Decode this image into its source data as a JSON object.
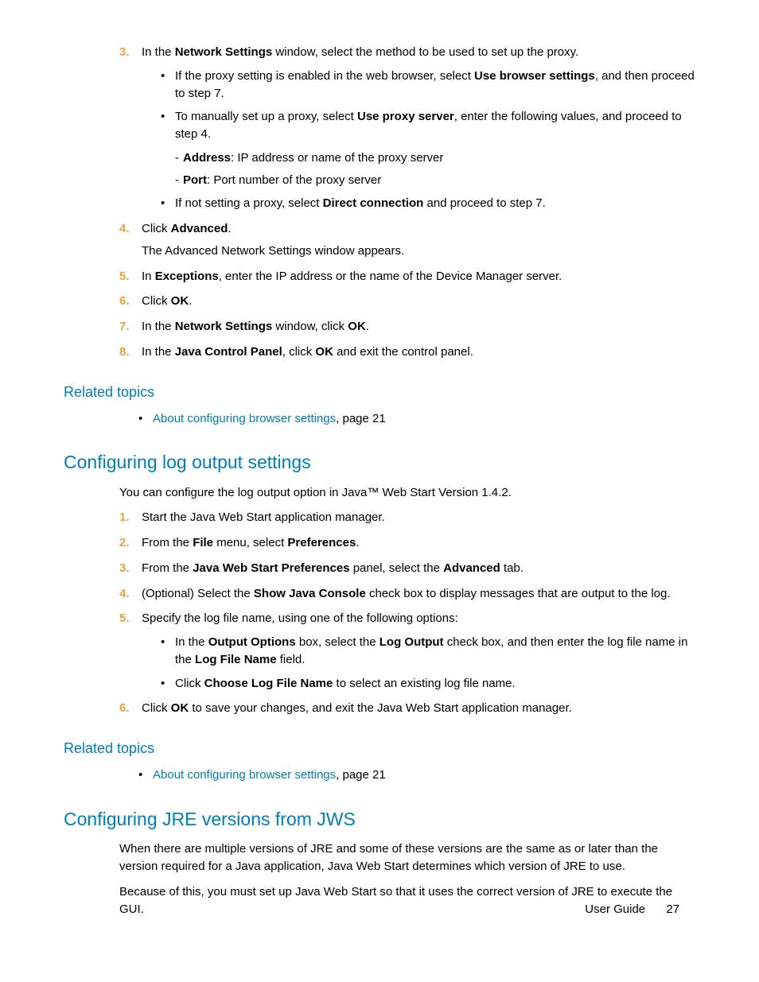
{
  "list1": {
    "n3": "3.",
    "i3a": "In the ",
    "i3b": "Network Settings",
    "i3c": " window, select the method to be used to set up the proxy.",
    "b1a": "If the proxy setting is enabled in the web browser, select ",
    "b1b": "Use browser settings",
    "b1c": ", and then proceed to step 7.",
    "b2a": "To manually set up a proxy, select ",
    "b2b": "Use proxy server",
    "b2c": ", enter the following values, and proceed to step 4.",
    "d1a": "Address",
    "d1b": ": IP address or name of the proxy server",
    "d2a": "Port",
    "d2b": ": Port number of the proxy server",
    "b3a": "If not setting a proxy, select ",
    "b3b": "Direct connection",
    "b3c": " and proceed to step 7.",
    "n4": "4.",
    "i4a": "Click ",
    "i4b": "Advanced",
    "i4c": ".",
    "i4d": "The Advanced Network Settings window appears.",
    "n5": "5.",
    "i5a": "In ",
    "i5b": "Exceptions",
    "i5c": ", enter the IP address or the name of the Device Manager server.",
    "n6": "6.",
    "i6a": "Click ",
    "i6b": "OK",
    "i6c": ".",
    "n7": "7.",
    "i7a": "In the ",
    "i7b": "Network Settings",
    "i7c": " window, click ",
    "i7d": "OK",
    "i7e": ".",
    "n8": "8.",
    "i8a": "In the ",
    "i8b": "Java Control Panel",
    "i8c": ", click ",
    "i8d": "OK",
    "i8e": " and exit the control panel."
  },
  "rel1": {
    "heading": "Related topics",
    "linkA": "About configuring browser settings",
    "linkB": ", page 21"
  },
  "sec2": {
    "title": "Configuring log output settings",
    "intro": "You can configure the log output option in Java™ Web Start Version 1.4.2.",
    "n1": "1.",
    "i1": "Start the Java Web Start application manager.",
    "n2": "2.",
    "i2a": "From the ",
    "i2b": "File",
    "i2c": " menu, select ",
    "i2d": "Preferences",
    "i2e": ".",
    "n3": "3.",
    "i3a": "From the ",
    "i3b": "Java Web Start Preferences",
    "i3c": " panel, select the ",
    "i3d": "Advanced",
    "i3e": " tab.",
    "n4": "4.",
    "i4a": "(Optional) Select the ",
    "i4b": "Show Java Console",
    "i4c": " check box to display messages that are output to the log.",
    "n5": "5.",
    "i5": "Specify the log file name, using one of the following options:",
    "b1a": "In the ",
    "b1b": "Output Options",
    "b1c": " box, select the ",
    "b1d": "Log Output",
    "b1e": " check box, and then enter the log file name in the ",
    "b1f": "Log File Name",
    "b1g": " field.",
    "b2a": "Click ",
    "b2b": "Choose Log File Name",
    "b2c": " to select an existing log file name.",
    "n6": "6.",
    "i6a": "Click ",
    "i6b": "OK",
    "i6c": " to save your changes, and exit the Java Web Start application manager."
  },
  "rel2": {
    "heading": "Related topics",
    "linkA": "About configuring browser settings",
    "linkB": ", page 21"
  },
  "sec3": {
    "title": "Configuring JRE versions from JWS",
    "p1": "When there are multiple versions of JRE and some of these versions are the same as or later than the version required for a Java application, Java Web Start determines which version of JRE to use.",
    "p2": "Because of this, you must set up Java Web Start so that it uses the correct version of JRE to execute the GUI."
  },
  "footer": {
    "label": "User Guide",
    "page": "27"
  }
}
